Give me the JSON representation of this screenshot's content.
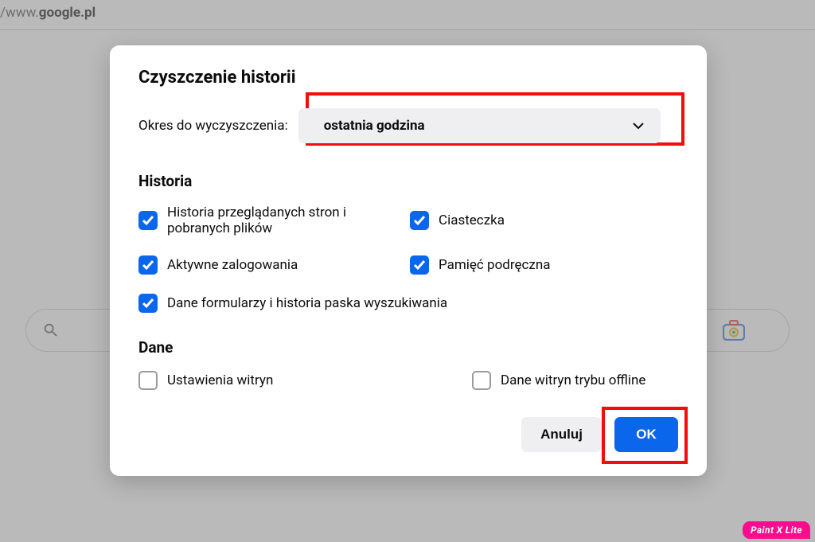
{
  "url": {
    "prefix": "/www.",
    "bold": "google.pl"
  },
  "dialog": {
    "title": "Czyszczenie historii",
    "range_label": "Okres do wyczyszczenia:",
    "range_value": "ostatnia godzina"
  },
  "historia": {
    "heading": "Historia",
    "items": [
      {
        "label": "Historia przeglądanych stron i pobranych plików",
        "checked": true
      },
      {
        "label": "Ciasteczka",
        "checked": true
      },
      {
        "label": "Aktywne zalogowania",
        "checked": true
      },
      {
        "label": "Pamięć podręczna",
        "checked": true
      },
      {
        "label": "Dane formularzy i historia paska wyszukiwania",
        "checked": true
      }
    ]
  },
  "dane": {
    "heading": "Dane",
    "items": [
      {
        "label": "Ustawienia witryn",
        "checked": false
      },
      {
        "label": "Dane witryn trybu offline",
        "checked": false
      }
    ]
  },
  "buttons": {
    "cancel": "Anuluj",
    "ok": "OK"
  },
  "watermark": "Paint X Lite"
}
